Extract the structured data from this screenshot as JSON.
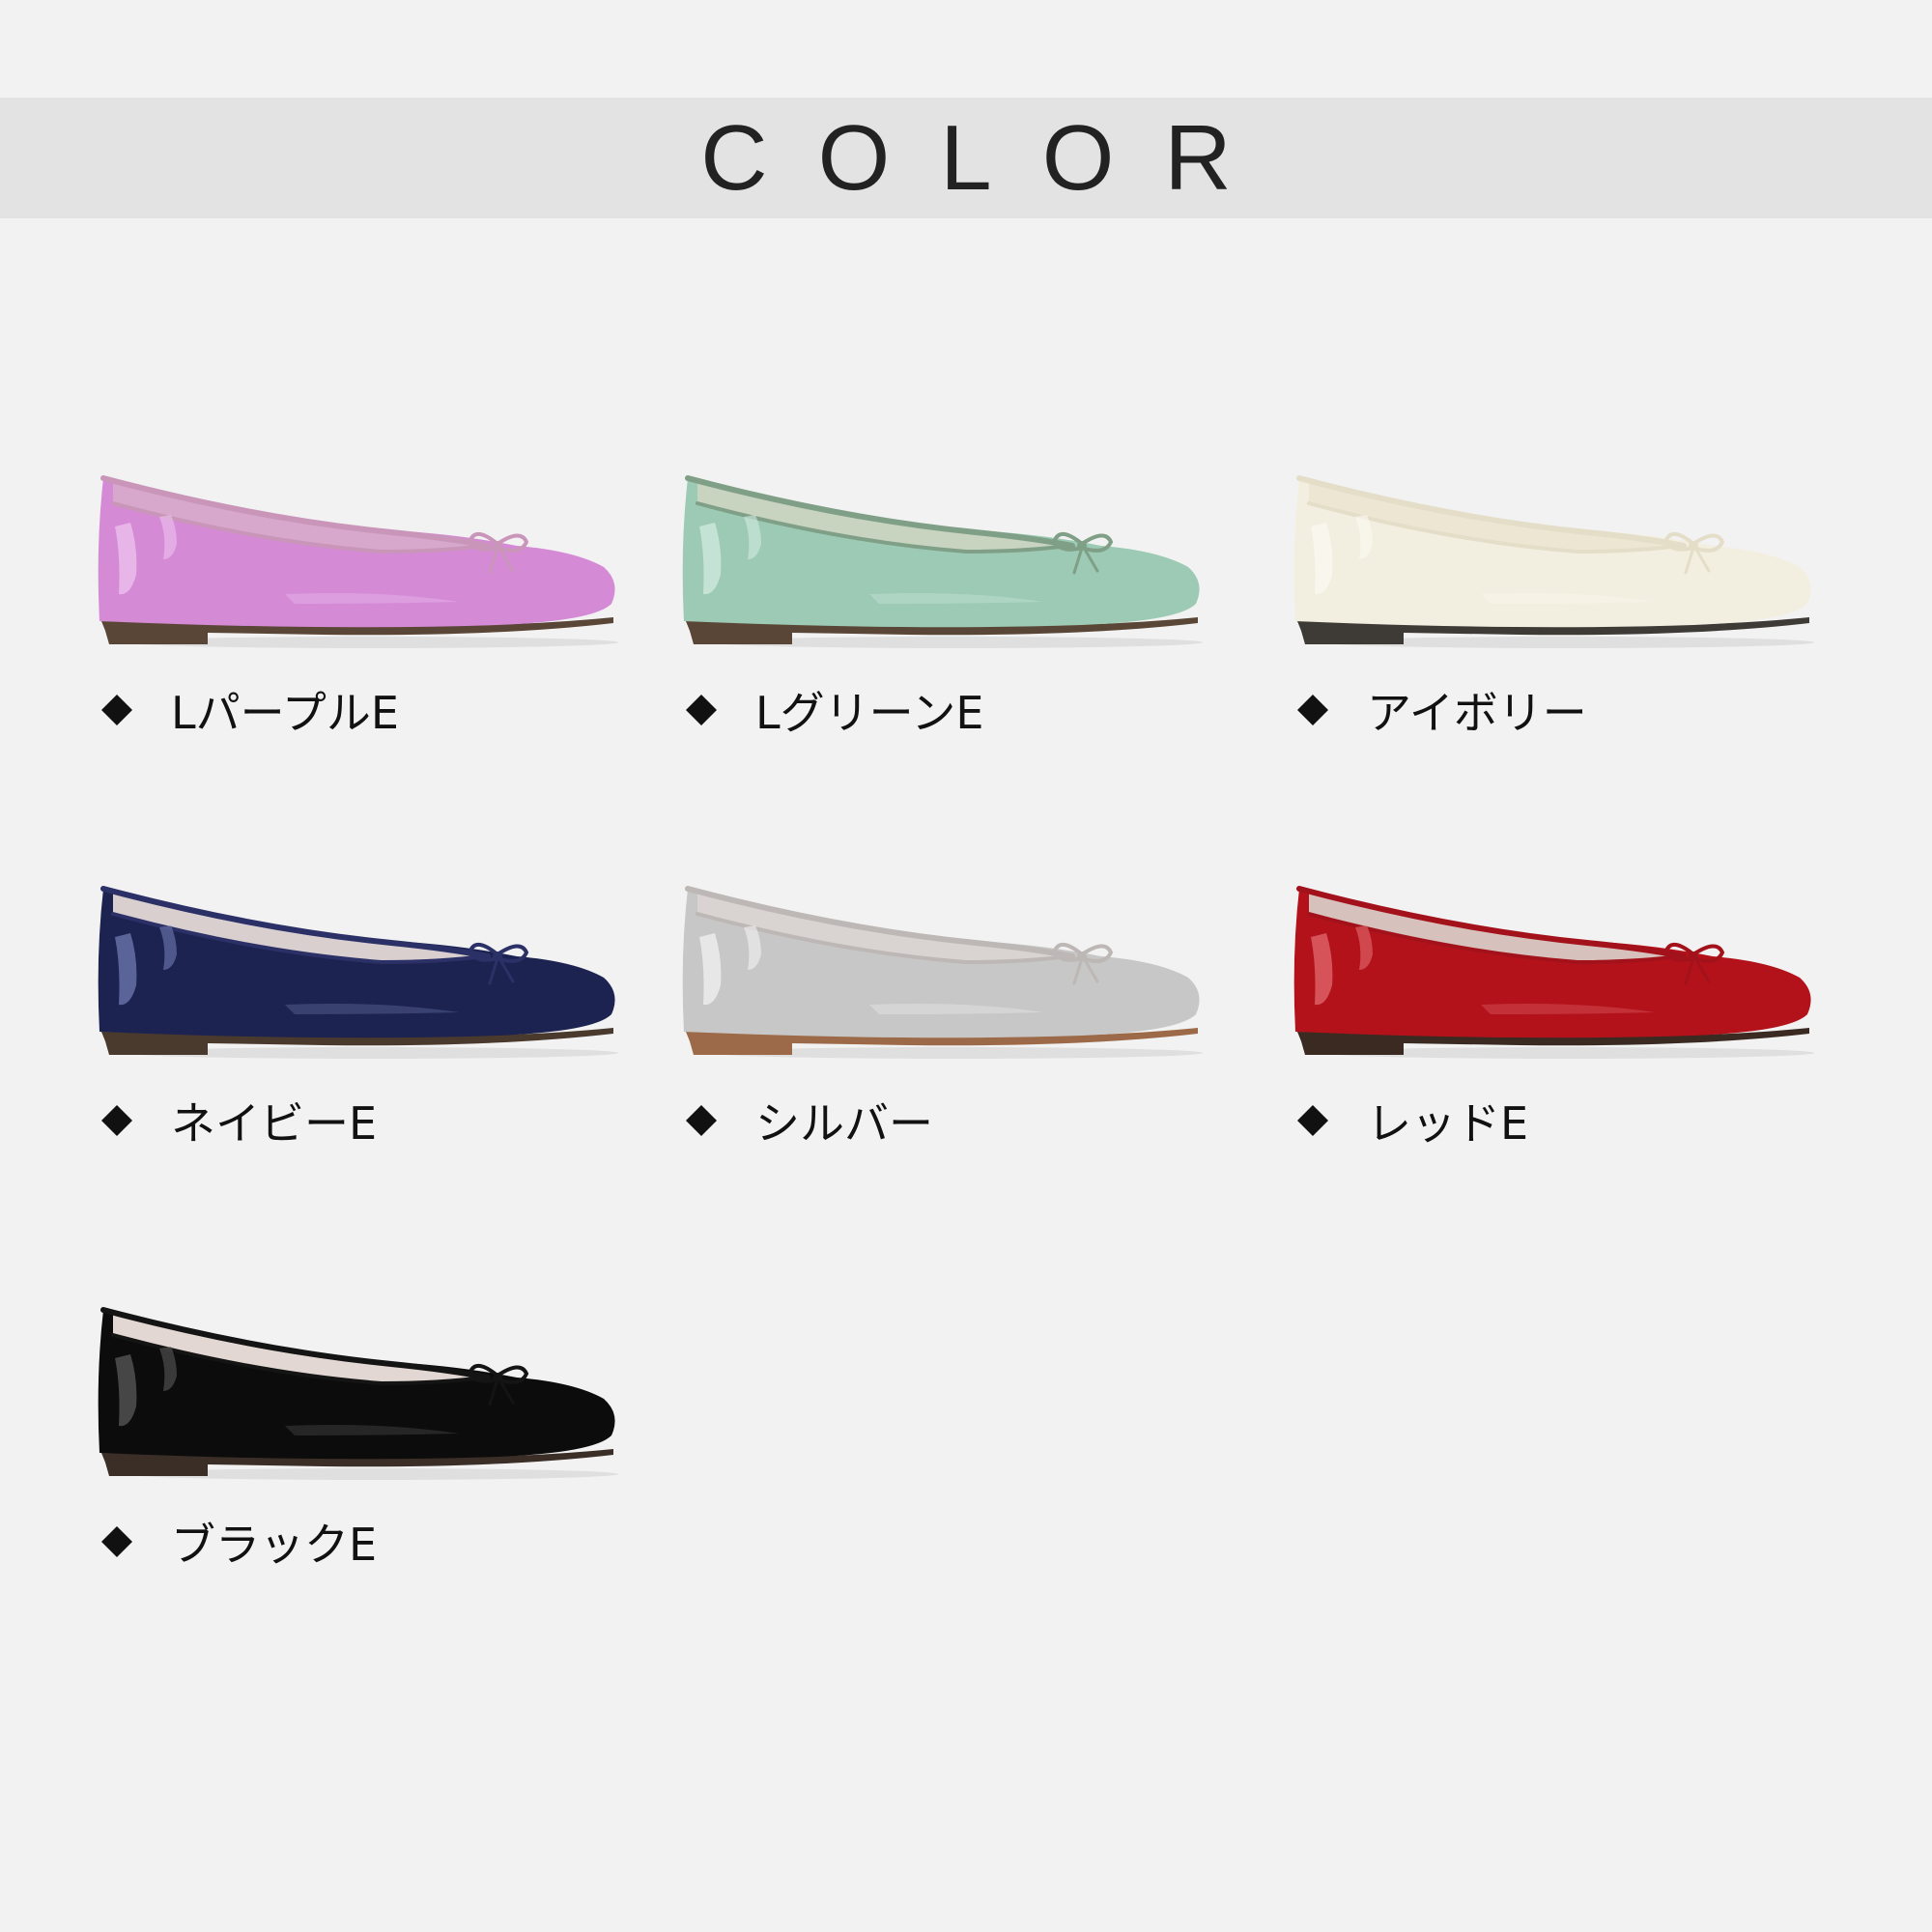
{
  "header": {
    "title": "COLOR"
  },
  "colors": [
    {
      "label": "LパープルE",
      "upper": "#d58ad6",
      "highlight": "#ecc3ee",
      "inner": "#d7a7cc",
      "trim": "#c996b9",
      "sole": "#5a4636",
      "icon": "shoe-icon"
    },
    {
      "label": "LグリーンE",
      "upper": "#9ccab4",
      "highlight": "#d2ebdf",
      "inner": "#c9d4c0",
      "trim": "#7f9f86",
      "sole": "#5a4636",
      "icon": "shoe-icon"
    },
    {
      "label": "アイボリー",
      "upper": "#f3efe0",
      "highlight": "#fbf9f1",
      "inner": "#ece6d2",
      "trim": "#e4dec9",
      "sole": "#3e3a36",
      "icon": "shoe-icon"
    },
    {
      "label": "ネイビーE",
      "upper": "#1c2350",
      "highlight": "#6f7bb0",
      "inner": "#d9cfcf",
      "trim": "#2b3166",
      "sole": "#4a3a2e",
      "icon": "shoe-icon"
    },
    {
      "label": "シルバー",
      "upper": "#c7c7c7",
      "highlight": "#f1f1f1",
      "inner": "#d9d4d2",
      "trim": "#bdb7b5",
      "sole": "#9c6a48",
      "icon": "shoe-icon"
    },
    {
      "label": "レッドE",
      "upper": "#b3121b",
      "highlight": "#e26a6f",
      "inner": "#d6c1bd",
      "trim": "#a3121a",
      "sole": "#3a2a22",
      "icon": "shoe-icon"
    },
    {
      "label": "ブラックE",
      "upper": "#0c0c0c",
      "highlight": "#5a5a5a",
      "inner": "#e2d7d2",
      "trim": "#141414",
      "sole": "#3a2e26",
      "icon": "shoe-icon"
    }
  ],
  "bullet_icon": "diamond-bullet-icon"
}
